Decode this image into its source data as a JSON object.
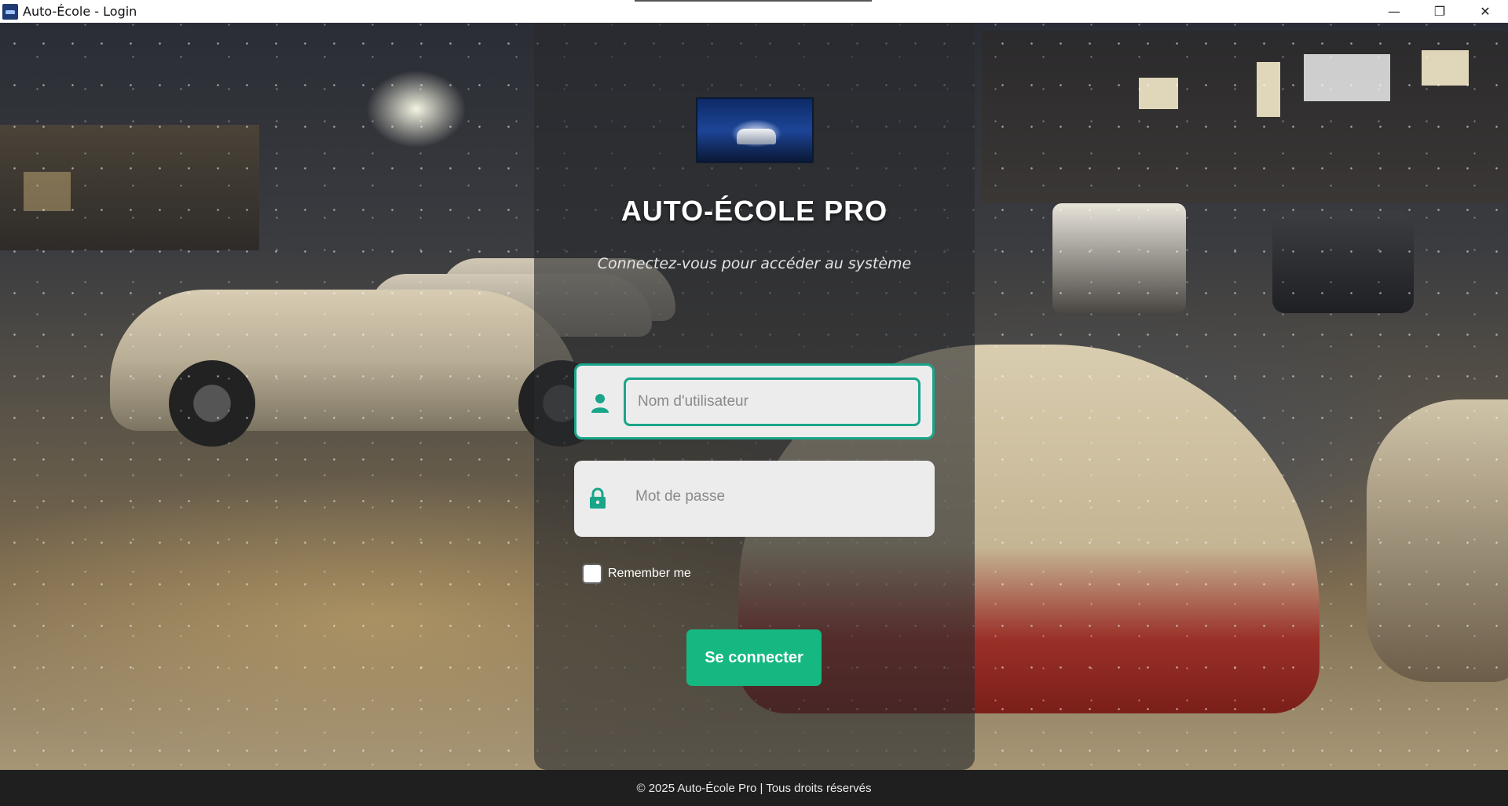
{
  "window": {
    "title": "Auto-École - Login",
    "controls": {
      "minimize": "—",
      "maximize": "❐",
      "close": "✕"
    }
  },
  "login": {
    "brand_title": "AUTO-ÉCOLE PRO",
    "subtitle": "Connectez-vous pour accéder au système",
    "username": {
      "placeholder": "Nom d'utilisateur",
      "value": ""
    },
    "password": {
      "placeholder": "Mot de passe",
      "value": ""
    },
    "remember_me": {
      "label": "Remember me",
      "checked": false
    },
    "submit_label": "Se connecter"
  },
  "footer": {
    "text": "© 2025 Auto-École Pro | Tous droits réservés"
  },
  "colors": {
    "accent": "#16b882",
    "field_border": "#1aa58a",
    "footer_bg": "#1f1f1f"
  },
  "icons": {
    "username": "user-icon",
    "password": "lock-icon",
    "app": "app-logo-icon"
  }
}
